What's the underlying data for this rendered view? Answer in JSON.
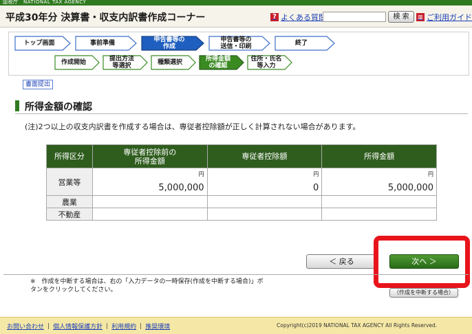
{
  "agency": "国税庁　NATIONAL TAX AGENCY",
  "header": {
    "title": "平成30年分 決算書・収支内訳書作成コーナー",
    "faq_label": "よくある質問",
    "search_label": "検 索",
    "guide_label": "ご利用ガイド",
    "search_value": ""
  },
  "steps": {
    "main": [
      {
        "label": "トップ画面",
        "state": "done"
      },
      {
        "label": "事前準備",
        "state": "done"
      },
      {
        "label": "申告書等の\n作成",
        "state": "active"
      },
      {
        "label": "申告書等の\n送信・印刷",
        "state": "todo"
      },
      {
        "label": "終了",
        "state": "todo"
      }
    ],
    "sub": [
      {
        "label": "作成開始",
        "state": "done"
      },
      {
        "label": "提出方法\n等選択",
        "state": "done"
      },
      {
        "label": "種類選択",
        "state": "done"
      },
      {
        "label": "所得金額\nの確認",
        "state": "active"
      },
      {
        "label": "住所・氏名\n等入力",
        "state": "todo"
      }
    ]
  },
  "doc_link": "書面提出",
  "section_title": "所得金額の確認",
  "note": "(注)2つ以上の収支内訳書を作成する場合は、専従者控除額が正しく計算されない場合があります。",
  "table": {
    "headers": [
      "所得区分",
      "専従者控除前の\n所得金額",
      "専従者控除額",
      "所得金額"
    ],
    "unit": "円",
    "rows": [
      {
        "category": "営業等",
        "values": [
          "5,000,000",
          "0",
          "5,000,000"
        ]
      },
      {
        "category": "農業",
        "values": [
          "",
          "",
          ""
        ]
      },
      {
        "category": "不動産",
        "values": [
          "",
          "",
          ""
        ]
      }
    ]
  },
  "buttons": {
    "back": "＜ 戻る",
    "next": "次へ ＞",
    "suspend": "（作成を中断する場合）"
  },
  "bottom_note": "※　作成を中断する場合は、右の「入力データの一時保存(作成を中断する場合)」ボタンをクリックしてください。",
  "footer": {
    "links": [
      "お問い合わせ",
      "個人情報保護方針",
      "利用規約",
      "推奨環境"
    ],
    "copyright": "Copyright(c)2019 NATIONAL TAX AGENCY All Rights Reserved."
  },
  "colors": {
    "brand_green": "#2f7a1f",
    "active_step": "#1f5fbf",
    "active_sub_step": "#3a8a22",
    "highlight": "#e8141b"
  }
}
